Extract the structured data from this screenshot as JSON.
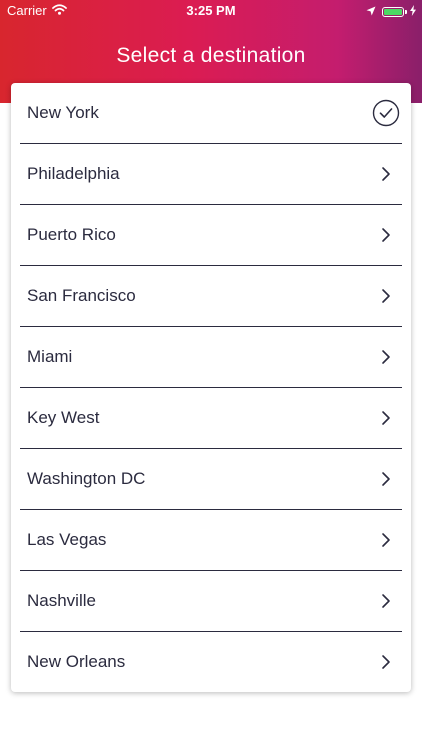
{
  "status_bar": {
    "carrier": "Carrier",
    "time": "3:25 PM",
    "battery_level": 1.0
  },
  "header": {
    "title": "Select a destination"
  },
  "colors": {
    "header_gradient": [
      "#d8262e",
      "#db1c52",
      "#c41d6e",
      "#8a1f6a"
    ],
    "text": "#2b2b3f",
    "battery": "#4cd964"
  },
  "destinations": [
    {
      "label": "New York",
      "selected": true,
      "icon": "checkmark-circle-icon"
    },
    {
      "label": "Philadelphia",
      "selected": false,
      "icon": "chevron-right-icon"
    },
    {
      "label": "Puerto Rico",
      "selected": false,
      "icon": "chevron-right-icon"
    },
    {
      "label": "San Francisco",
      "selected": false,
      "icon": "chevron-right-icon"
    },
    {
      "label": "Miami",
      "selected": false,
      "icon": "chevron-right-icon"
    },
    {
      "label": "Key West",
      "selected": false,
      "icon": "chevron-right-icon"
    },
    {
      "label": "Washington DC",
      "selected": false,
      "icon": "chevron-right-icon"
    },
    {
      "label": "Las Vegas",
      "selected": false,
      "icon": "chevron-right-icon"
    },
    {
      "label": "Nashville",
      "selected": false,
      "icon": "chevron-right-icon"
    },
    {
      "label": "New Orleans",
      "selected": false,
      "icon": "chevron-right-icon"
    }
  ]
}
